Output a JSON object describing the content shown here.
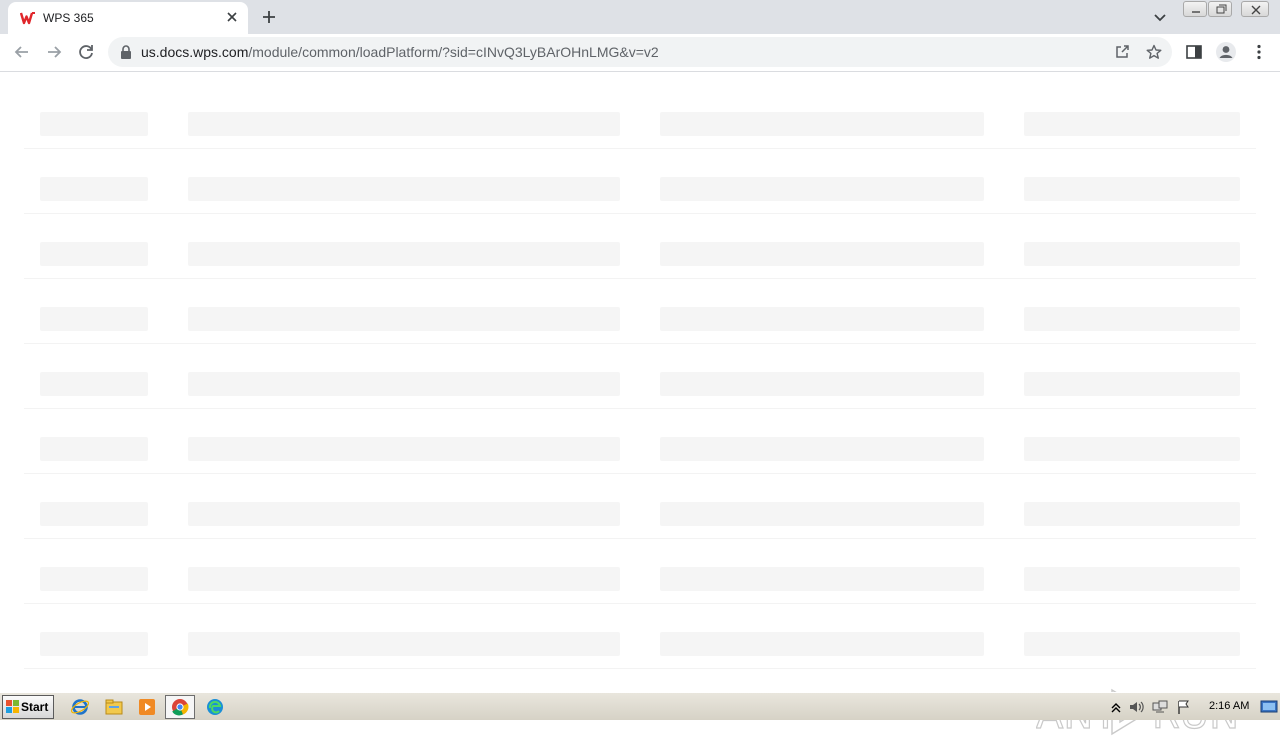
{
  "browser": {
    "tab": {
      "title": "WPS 365",
      "favicon": "wps-logo-icon"
    },
    "url": {
      "host": "us.docs.wps.com",
      "path": "/module/common/loadPlatform/?sid=cINvQ3LyBArOHnLMG&v=v2"
    },
    "toolbar_icons": [
      "back-icon",
      "forward-icon",
      "reload-icon",
      "share-icon",
      "star-icon",
      "side-panel-icon",
      "profile-icon",
      "menu-icon"
    ]
  },
  "page": {
    "state": "loading-skeleton",
    "skeleton_rows": 9,
    "skeleton_columns": 4
  },
  "watermark": {
    "text": "ANY RUN"
  },
  "taskbar": {
    "start_label": "Start",
    "apps": [
      "internet-explorer-icon",
      "file-explorer-icon",
      "media-player-icon",
      "chrome-icon",
      "edge-icon"
    ],
    "tray_icons": [
      "show-hidden-icon",
      "volume-icon",
      "network-icon",
      "flag-icon"
    ],
    "clock": "2:16 AM"
  },
  "colors": {
    "tabstrip": "#dee1e6",
    "omnibox": "#f1f3f4",
    "skeleton": "#f5f5f5",
    "wps_red": "#e0262b",
    "taskbar": "#d6d2c6"
  }
}
